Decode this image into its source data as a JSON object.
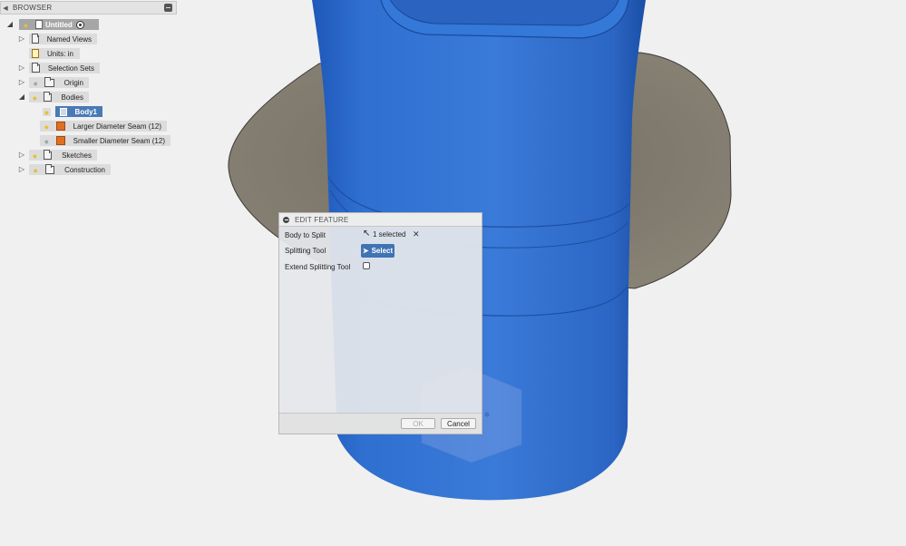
{
  "browser": {
    "header_title": "BROWSER",
    "items": [
      {
        "label": "Untitled",
        "icon": "document-icon"
      },
      {
        "label": "Named Views",
        "icon": "folder-icon"
      },
      {
        "label": "Units: in",
        "icon": "units-icon"
      },
      {
        "label": "Selection Sets",
        "icon": "folder-icon"
      },
      {
        "label": "Origin",
        "icon": "folder-icon"
      },
      {
        "label": "Bodies",
        "icon": "folder-icon"
      },
      {
        "label": "Body1",
        "icon": "body-icon"
      },
      {
        "label": "Larger Diameter Seam (12)",
        "icon": "seam-icon"
      },
      {
        "label": "Smaller Diameter Seam (12)",
        "icon": "seam-icon"
      },
      {
        "label": "Sketches",
        "icon": "folder-icon"
      },
      {
        "label": "Construction",
        "icon": "folder-icon"
      }
    ]
  },
  "dialog": {
    "title": "EDIT FEATURE",
    "body_to_split_label": "Body to Split",
    "body_to_split_value": "1 selected",
    "splitting_tool_label": "Splitting Tool",
    "select_button_label": "Select",
    "extend_label": "Extend Splitting Tool",
    "extend_checked": false,
    "ok_label": "OK",
    "cancel_label": "Cancel"
  },
  "colors": {
    "body_blue": "#2f6fcf",
    "plate_gray": "#7d776c",
    "selection_blue": "#4a7ab5",
    "background": "#f0f0f0"
  }
}
